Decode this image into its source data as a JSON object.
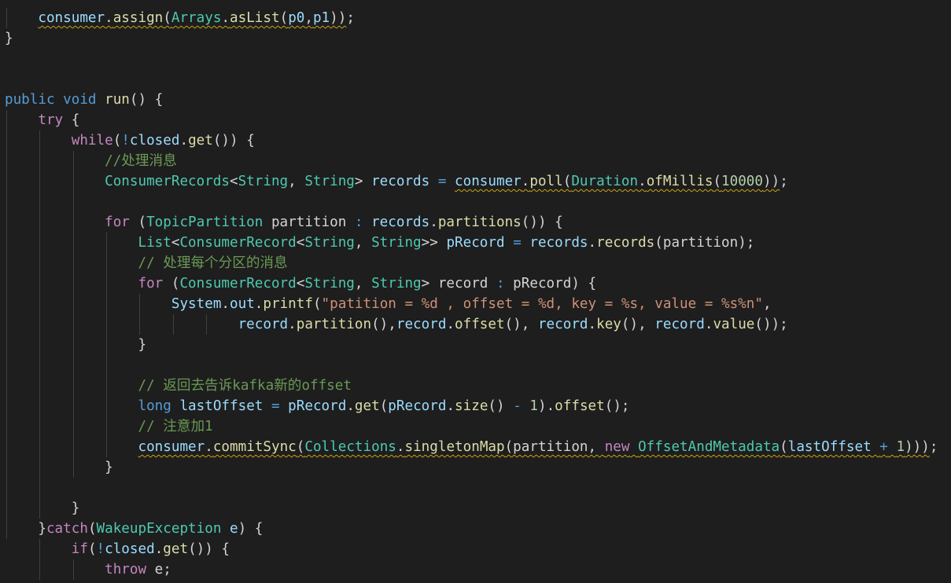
{
  "editor": {
    "language": "java",
    "theme": "dark",
    "lines": [
      [
        {
          "t": "    ",
          "c": "pun"
        },
        {
          "t": "consumer",
          "c": "id",
          "w": 1
        },
        {
          "t": ".",
          "c": "pun",
          "w": 1
        },
        {
          "t": "assign",
          "c": "fn",
          "w": 1
        },
        {
          "t": "(",
          "c": "pun",
          "w": 1
        },
        {
          "t": "Arrays",
          "c": "ty",
          "w": 1
        },
        {
          "t": ".",
          "c": "pun",
          "w": 1
        },
        {
          "t": "asList",
          "c": "fn",
          "w": 1
        },
        {
          "t": "(",
          "c": "pun",
          "w": 1
        },
        {
          "t": "p0",
          "c": "id",
          "w": 1
        },
        {
          "t": ",",
          "c": "pun",
          "w": 1
        },
        {
          "t": "p1",
          "c": "id",
          "w": 1
        },
        {
          "t": "))",
          "c": "pun",
          "w": 1
        },
        {
          "t": ";",
          "c": "pun"
        }
      ],
      [
        {
          "t": "}",
          "c": "pun"
        }
      ],
      [],
      [],
      [
        {
          "t": "public",
          "c": "kw"
        },
        {
          "t": " ",
          "c": "pun"
        },
        {
          "t": "void",
          "c": "kw"
        },
        {
          "t": " ",
          "c": "pun"
        },
        {
          "t": "run",
          "c": "fn"
        },
        {
          "t": "() {",
          "c": "pun"
        }
      ],
      [
        {
          "t": "    ",
          "c": "pun"
        },
        {
          "t": "try",
          "c": "ctl"
        },
        {
          "t": " {",
          "c": "pun"
        }
      ],
      [
        {
          "t": "        ",
          "c": "pun"
        },
        {
          "t": "while",
          "c": "ctl"
        },
        {
          "t": "(",
          "c": "pun"
        },
        {
          "t": "!",
          "c": "kw"
        },
        {
          "t": "closed",
          "c": "id"
        },
        {
          "t": ".",
          "c": "pun"
        },
        {
          "t": "get",
          "c": "fn"
        },
        {
          "t": "()) {",
          "c": "pun"
        }
      ],
      [
        {
          "t": "            ",
          "c": "pun"
        },
        {
          "t": "//处理消息",
          "c": "cm"
        }
      ],
      [
        {
          "t": "            ",
          "c": "pun"
        },
        {
          "t": "ConsumerRecords",
          "c": "ty"
        },
        {
          "t": "<",
          "c": "pun"
        },
        {
          "t": "String",
          "c": "ty"
        },
        {
          "t": ", ",
          "c": "pun"
        },
        {
          "t": "String",
          "c": "ty"
        },
        {
          "t": "> ",
          "c": "pun"
        },
        {
          "t": "records",
          "c": "id"
        },
        {
          "t": " ",
          "c": "pun"
        },
        {
          "t": "=",
          "c": "kw"
        },
        {
          "t": " ",
          "c": "pun"
        },
        {
          "t": "consumer",
          "c": "id",
          "w": 1
        },
        {
          "t": ".",
          "c": "pun",
          "w": 1
        },
        {
          "t": "poll",
          "c": "fn",
          "w": 1
        },
        {
          "t": "(",
          "c": "pun",
          "w": 1
        },
        {
          "t": "Duration",
          "c": "ty",
          "w": 1
        },
        {
          "t": ".",
          "c": "pun",
          "w": 1
        },
        {
          "t": "ofMillis",
          "c": "fn",
          "w": 1
        },
        {
          "t": "(",
          "c": "pun",
          "w": 1
        },
        {
          "t": "10000",
          "c": "num",
          "w": 1
        },
        {
          "t": "))",
          "c": "pun",
          "w": 1
        },
        {
          "t": ";",
          "c": "pun"
        }
      ],
      [],
      [
        {
          "t": "            ",
          "c": "pun"
        },
        {
          "t": "for",
          "c": "ctl"
        },
        {
          "t": " (",
          "c": "pun"
        },
        {
          "t": "TopicPartition",
          "c": "ty"
        },
        {
          "t": " partition ",
          "c": "pun"
        },
        {
          "t": ":",
          "c": "kw"
        },
        {
          "t": " ",
          "c": "pun"
        },
        {
          "t": "records",
          "c": "id"
        },
        {
          "t": ".",
          "c": "pun"
        },
        {
          "t": "partitions",
          "c": "fn"
        },
        {
          "t": "()) {",
          "c": "pun"
        }
      ],
      [
        {
          "t": "                ",
          "c": "pun"
        },
        {
          "t": "List",
          "c": "ty"
        },
        {
          "t": "<",
          "c": "pun"
        },
        {
          "t": "ConsumerRecord",
          "c": "ty"
        },
        {
          "t": "<",
          "c": "pun"
        },
        {
          "t": "String",
          "c": "ty"
        },
        {
          "t": ", ",
          "c": "pun"
        },
        {
          "t": "String",
          "c": "ty"
        },
        {
          "t": ">> ",
          "c": "pun"
        },
        {
          "t": "pRecord",
          "c": "id"
        },
        {
          "t": " ",
          "c": "pun"
        },
        {
          "t": "=",
          "c": "kw"
        },
        {
          "t": " ",
          "c": "pun"
        },
        {
          "t": "records",
          "c": "id"
        },
        {
          "t": ".",
          "c": "pun"
        },
        {
          "t": "records",
          "c": "fn"
        },
        {
          "t": "(partition);",
          "c": "pun"
        }
      ],
      [
        {
          "t": "                ",
          "c": "pun"
        },
        {
          "t": "// 处理每个分区的消息",
          "c": "cm"
        }
      ],
      [
        {
          "t": "                ",
          "c": "pun"
        },
        {
          "t": "for",
          "c": "ctl"
        },
        {
          "t": " (",
          "c": "pun"
        },
        {
          "t": "ConsumerRecord",
          "c": "ty"
        },
        {
          "t": "<",
          "c": "pun"
        },
        {
          "t": "String",
          "c": "ty"
        },
        {
          "t": ", ",
          "c": "pun"
        },
        {
          "t": "String",
          "c": "ty"
        },
        {
          "t": "> record ",
          "c": "pun"
        },
        {
          "t": ":",
          "c": "kw"
        },
        {
          "t": " pRecord) {",
          "c": "pun"
        }
      ],
      [
        {
          "t": "                    ",
          "c": "pun"
        },
        {
          "t": "System",
          "c": "id"
        },
        {
          "t": ".",
          "c": "pun"
        },
        {
          "t": "out",
          "c": "id"
        },
        {
          "t": ".",
          "c": "pun"
        },
        {
          "t": "printf",
          "c": "fn"
        },
        {
          "t": "(",
          "c": "pun"
        },
        {
          "t": "\"patition = %d , offset = %d, key = %s, value = %s%n\"",
          "c": "str"
        },
        {
          "t": ",",
          "c": "pun"
        }
      ],
      [
        {
          "t": "                            ",
          "c": "pun"
        },
        {
          "t": "record",
          "c": "id"
        },
        {
          "t": ".",
          "c": "pun"
        },
        {
          "t": "partition",
          "c": "fn"
        },
        {
          "t": "(),",
          "c": "pun"
        },
        {
          "t": "record",
          "c": "id"
        },
        {
          "t": ".",
          "c": "pun"
        },
        {
          "t": "offset",
          "c": "fn"
        },
        {
          "t": "(), ",
          "c": "pun"
        },
        {
          "t": "record",
          "c": "id"
        },
        {
          "t": ".",
          "c": "pun"
        },
        {
          "t": "key",
          "c": "fn"
        },
        {
          "t": "(), ",
          "c": "pun"
        },
        {
          "t": "record",
          "c": "id"
        },
        {
          "t": ".",
          "c": "pun"
        },
        {
          "t": "value",
          "c": "fn"
        },
        {
          "t": "());",
          "c": "pun"
        }
      ],
      [
        {
          "t": "                }",
          "c": "pun"
        }
      ],
      [],
      [
        {
          "t": "                ",
          "c": "pun"
        },
        {
          "t": "// 返回去告诉kafka新的offset",
          "c": "cm"
        }
      ],
      [
        {
          "t": "                ",
          "c": "pun"
        },
        {
          "t": "long",
          "c": "kw"
        },
        {
          "t": " ",
          "c": "pun"
        },
        {
          "t": "lastOffset",
          "c": "id"
        },
        {
          "t": " ",
          "c": "pun"
        },
        {
          "t": "=",
          "c": "kw"
        },
        {
          "t": " ",
          "c": "pun"
        },
        {
          "t": "pRecord",
          "c": "id"
        },
        {
          "t": ".",
          "c": "pun"
        },
        {
          "t": "get",
          "c": "fn"
        },
        {
          "t": "(",
          "c": "pun"
        },
        {
          "t": "pRecord",
          "c": "id"
        },
        {
          "t": ".",
          "c": "pun"
        },
        {
          "t": "size",
          "c": "fn"
        },
        {
          "t": "() ",
          "c": "pun"
        },
        {
          "t": "-",
          "c": "kw"
        },
        {
          "t": " ",
          "c": "pun"
        },
        {
          "t": "1",
          "c": "num"
        },
        {
          "t": ").",
          "c": "pun"
        },
        {
          "t": "offset",
          "c": "fn"
        },
        {
          "t": "();",
          "c": "pun"
        }
      ],
      [
        {
          "t": "                ",
          "c": "pun"
        },
        {
          "t": "// 注意加1",
          "c": "cm"
        }
      ],
      [
        {
          "t": "                ",
          "c": "pun"
        },
        {
          "t": "consumer",
          "c": "id",
          "w": 1
        },
        {
          "t": ".",
          "c": "pun",
          "w": 1
        },
        {
          "t": "commitSync",
          "c": "fn",
          "w": 1
        },
        {
          "t": "(",
          "c": "pun",
          "w": 1
        },
        {
          "t": "Collections",
          "c": "ty",
          "w": 1
        },
        {
          "t": ".",
          "c": "pun",
          "w": 1
        },
        {
          "t": "singletonMap",
          "c": "fn",
          "w": 1
        },
        {
          "t": "(partition, ",
          "c": "pun",
          "w": 1
        },
        {
          "t": "new",
          "c": "ctl",
          "w": 1
        },
        {
          "t": " ",
          "c": "pun",
          "w": 1
        },
        {
          "t": "OffsetAndMetadata",
          "c": "ty",
          "w": 1
        },
        {
          "t": "(",
          "c": "pun",
          "w": 1
        },
        {
          "t": "lastOffset",
          "c": "id",
          "w": 1
        },
        {
          "t": " ",
          "c": "pun",
          "w": 1
        },
        {
          "t": "+",
          "c": "kw",
          "w": 1
        },
        {
          "t": " ",
          "c": "pun",
          "w": 1
        },
        {
          "t": "1",
          "c": "num",
          "w": 1
        },
        {
          "t": ")))",
          "c": "pun",
          "w": 1
        },
        {
          "t": ";",
          "c": "pun"
        }
      ],
      [
        {
          "t": "            }",
          "c": "pun"
        }
      ],
      [],
      [
        {
          "t": "        }",
          "c": "pun"
        }
      ],
      [
        {
          "t": "    }",
          "c": "pun"
        },
        {
          "t": "catch",
          "c": "ctl"
        },
        {
          "t": "(",
          "c": "pun"
        },
        {
          "t": "WakeupException",
          "c": "ty"
        },
        {
          "t": " ",
          "c": "pun"
        },
        {
          "t": "e",
          "c": "id"
        },
        {
          "t": ") {",
          "c": "pun"
        }
      ],
      [
        {
          "t": "        ",
          "c": "pun"
        },
        {
          "t": "if",
          "c": "ctl"
        },
        {
          "t": "(",
          "c": "pun"
        },
        {
          "t": "!",
          "c": "kw"
        },
        {
          "t": "closed",
          "c": "id"
        },
        {
          "t": ".",
          "c": "pun"
        },
        {
          "t": "get",
          "c": "fn"
        },
        {
          "t": "()) {",
          "c": "pun"
        }
      ],
      [
        {
          "t": "            ",
          "c": "pun"
        },
        {
          "t": "throw",
          "c": "ctl"
        },
        {
          "t": " e;",
          "c": "pun"
        }
      ]
    ]
  }
}
